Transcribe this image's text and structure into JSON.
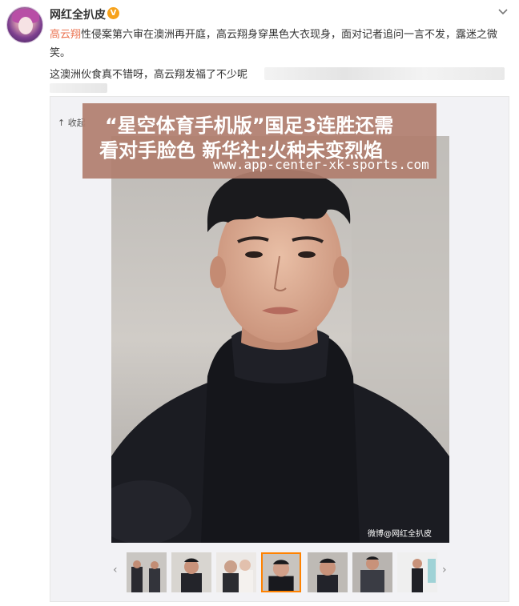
{
  "post": {
    "username": "网红全扒皮",
    "verified_badge": "V",
    "mention": "高云翔",
    "body_text": "性侵案第六审在澳洲再开庭，高云翔身穿黑色大衣现身，面对记者追问一言不发，露迷之微笑。",
    "second_line": "这澳洲伙食真不错呀，高云翔发福了不少呢"
  },
  "media": {
    "collapse_label": "收起",
    "watermark": "微博@网红全扒皮",
    "overlay": {
      "line1": "“星空体育手机版”国足3连胜还需",
      "line2": "看对手脸色 新华社:火种未变烈焰",
      "url": "www.app-center-xk-sports.com"
    }
  },
  "icons": {
    "menu": "chevron-down-icon",
    "collapse": "arrow-up-icon",
    "prev": "chevron-left-icon",
    "next": "chevron-right-icon"
  },
  "colors": {
    "mention": "#eb7350",
    "overlay_bg": "#b17e6e",
    "thumb_active": "#ff8200",
    "badge": "#f7a21b"
  }
}
